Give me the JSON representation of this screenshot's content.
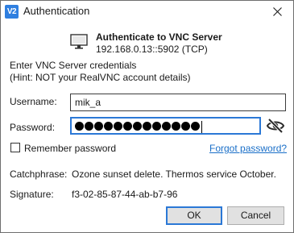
{
  "window": {
    "title": "Authentication",
    "app_icon_text": "V2"
  },
  "header": {
    "title": "Authenticate to VNC Server",
    "address": "192.168.0.13::5902 (TCP)"
  },
  "instructions": {
    "line1": "Enter VNC Server credentials",
    "line2": "(Hint: NOT your RealVNC account details)"
  },
  "form": {
    "username_label": "Username:",
    "username_value": "mik_a",
    "password_label": "Password:",
    "password_masked_length": 13,
    "remember_label": "Remember password",
    "remember_checked": false,
    "forgot_link": "Forgot password?"
  },
  "identity": {
    "catchphrase_label": "Catchphrase:",
    "catchphrase_value": "Ozone sunset delete. Thermos service October.",
    "signature_label": "Signature:",
    "signature_value": "f3-02-85-87-44-ab-b7-96"
  },
  "buttons": {
    "ok": "OK",
    "cancel": "Cancel"
  },
  "colors": {
    "link": "#1a6fc8",
    "focus_border": "#2b78d6",
    "app_icon_bg": "#2f7fe0"
  },
  "icons": {
    "app": "vnc-viewer-icon",
    "close": "close-icon",
    "monitor": "monitor-icon",
    "reveal": "eye-slash-icon"
  }
}
